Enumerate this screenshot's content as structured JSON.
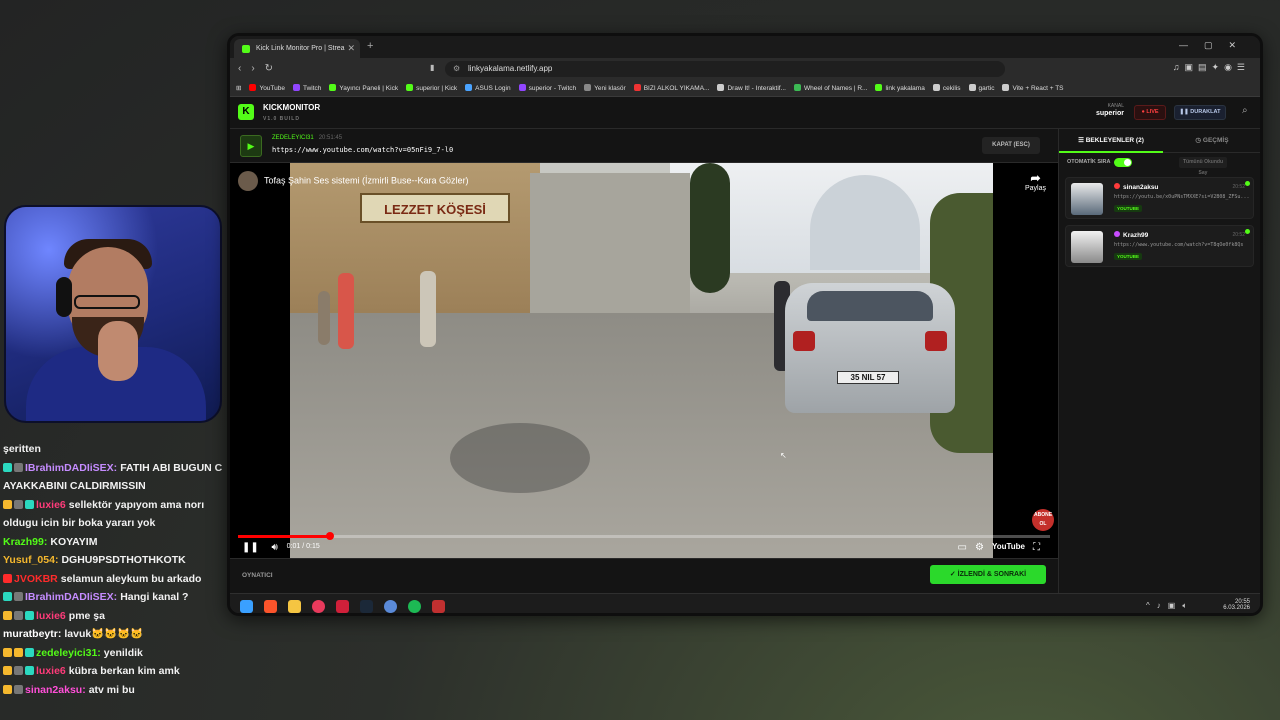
{
  "chat": [
    {
      "user": "",
      "msg": "şeritten",
      "color": "#ffffff",
      "badges": []
    },
    {
      "user": "IBrahimDADIiSEX:",
      "msg": "FATIH ABI BUGUN C",
      "color": "#c58cff",
      "badges": [
        "#2bd9c0",
        "#777"
      ]
    },
    {
      "user": "",
      "msg": "AYAKKABINI CALDIRMISSIN",
      "color": "#ffffff",
      "badges": []
    },
    {
      "user": "luxie6",
      "msg": "sellektör yapıyom ama norı",
      "color": "#ff3b7a",
      "badges": [
        "#f5b82e",
        "#777",
        "#2bd9c0"
      ]
    },
    {
      "user": "",
      "msg": "oldugu icin bir boka yararı yok",
      "color": "#ffffff",
      "badges": []
    },
    {
      "user": "Krazh99:",
      "msg": "KOYAYIM",
      "color": "#53fc18",
      "badges": []
    },
    {
      "user": "Yusuf_054:",
      "msg": "DGHU9PSDTHOTHKOTK",
      "color": "#f5b82e",
      "badges": []
    },
    {
      "user": "JVOKBR",
      "msg": "selamun aleykum bu arkado",
      "color": "#ff2b2b",
      "badges": [
        "#ff2b2b"
      ]
    },
    {
      "user": "IBrahimDADIiSEX:",
      "msg": "Hangi kanal ?",
      "color": "#c58cff",
      "badges": [
        "#2bd9c0",
        "#777"
      ]
    },
    {
      "user": "luxie6",
      "msg": "pme şa",
      "color": "#ff3b7a",
      "badges": [
        "#f5b82e",
        "#777",
        "#2bd9c0"
      ]
    },
    {
      "user": "muratbeytr:",
      "msg": "lavuk🐱🐱🐱🐱",
      "color": "#ffffff",
      "badges": []
    },
    {
      "user": "zedeleyici31:",
      "msg": "yenildik",
      "color": "#53fc18",
      "badges": [
        "#f5b82e",
        "#f5b82e",
        "#2bd9c0"
      ]
    },
    {
      "user": "luxie6",
      "msg": "kübra berkan kim amk",
      "color": "#ff3b7a",
      "badges": [
        "#f5b82e",
        "#777",
        "#2bd9c0"
      ]
    },
    {
      "user": "sinan2aksu:",
      "msg": "atv mi bu",
      "color": "#ff4fd8",
      "badges": [
        "#f5b82e",
        "#777"
      ]
    }
  ],
  "browser": {
    "tab_title": "Kick Link Monitor Pro | Strea",
    "url": "linkyakalama.netlify.app",
    "bookmarks": [
      {
        "label": "YouTube",
        "color": "#ff0000"
      },
      {
        "label": "Twitch",
        "color": "#9146ff"
      },
      {
        "label": "Yayıncı Paneli | Kick",
        "color": "#53fc18"
      },
      {
        "label": "superior | Kick",
        "color": "#53fc18"
      },
      {
        "label": "ASUS Login",
        "color": "#4aa3ff"
      },
      {
        "label": "superior - Twitch",
        "color": "#9146ff"
      },
      {
        "label": "Yeni klasör",
        "color": "#888"
      },
      {
        "label": "BIZI ALKOL YIKAMA...",
        "color": "#e33"
      },
      {
        "label": "Draw It! - Interaktif...",
        "color": "#ccc"
      },
      {
        "label": "Wheel of Names | R...",
        "color": "#3cba54"
      },
      {
        "label": "link yakalama",
        "color": "#53fc18"
      },
      {
        "label": "cekilis",
        "color": "#ccc"
      },
      {
        "label": "gartic",
        "color": "#ccc"
      },
      {
        "label": "Vite + React + TS",
        "color": "#ccc"
      }
    ]
  },
  "app": {
    "logo_letter": "K",
    "brand": "KICKMONITOR",
    "version": "V1.0 BUILD",
    "kanal_label": "KANAL",
    "kanal_value": "superior",
    "live_label": "LIVE",
    "pause_label": "DURAKLAT",
    "now_user": "ZEDELEYICI31",
    "now_time": "20:51:45",
    "now_url": "https://www.youtube.com/watch?v=05nFi9_7-l0",
    "close_label": "KAPAT (ESC)",
    "video_title": "Tofaş Şahin Ses sistemi (İzmirli Buse--Kara Gözler)",
    "share_label": "Paylaş",
    "abone_label": "ABONE OL",
    "sign_text": "LEZZET KÖŞESİ",
    "plate_text": "35 NIL 57",
    "time_current": "0:01",
    "time_total": "0:15",
    "progress": 0.113,
    "youtube_label": "YouTube",
    "footer_label": "OYNATICI",
    "next_label": "İZLENDİ & SONRAKİ",
    "queue_tab": "BEKLEYENLER (2)",
    "history_tab": "GEÇMİŞ",
    "auto_label": "OTOMATİK SIRA",
    "clear_label": "Tümünü Okundu Say",
    "queue": [
      {
        "name": "sinan2aksu",
        "time": "20:52",
        "url": "https://youtu.be/x0uPNsTMXXE?si=V2B08_ZFSu...",
        "tag": "YOUTUBE",
        "dot": "#ff3b3b"
      },
      {
        "name": "Krazh99",
        "time": "20:52",
        "url": "https://www.youtube.com/watch?v=T8qOe0fk8Qs",
        "tag": "YOUTUBE",
        "dot": "#c84cff"
      }
    ]
  },
  "taskbar": {
    "time": "20:55",
    "date": "6.03.2026"
  }
}
